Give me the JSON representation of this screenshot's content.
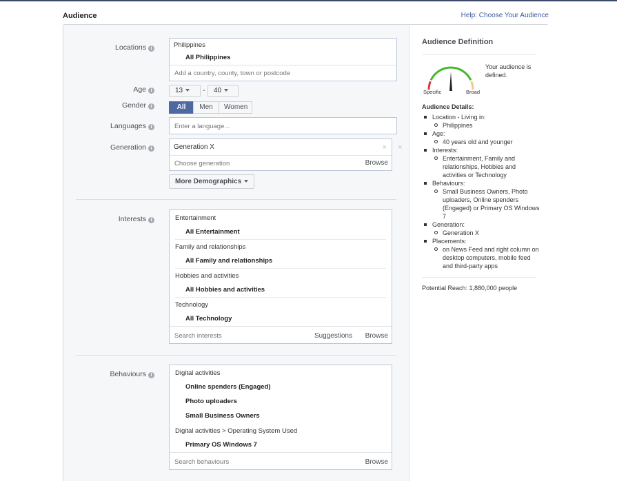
{
  "header": {
    "title": "Audience",
    "help_link": "Help: Choose Your Audience"
  },
  "form": {
    "locations": {
      "label": "Locations",
      "country": "Philippines",
      "item": "All Philippines",
      "placeholder": "Add a country, county, town or postcode"
    },
    "age": {
      "label": "Age",
      "min": "13",
      "separator": "-",
      "max": "40"
    },
    "gender": {
      "label": "Gender",
      "options": [
        "All",
        "Men",
        "Women"
      ],
      "selected": "All"
    },
    "languages": {
      "label": "Languages",
      "placeholder": "Enter a language..."
    },
    "generation": {
      "label": "Generation",
      "value": "Generation X",
      "placeholder": "Choose generation",
      "browse": "Browse",
      "clear_glyph": "×"
    },
    "more_demographics": "More Demographics",
    "interests": {
      "label": "Interests",
      "groups": [
        {
          "category": "Entertainment",
          "items": [
            "All Entertainment"
          ]
        },
        {
          "category": "Family and relationships",
          "items": [
            "All Family and relationships"
          ]
        },
        {
          "category": "Hobbies and activities",
          "items": [
            "All Hobbies and activities"
          ]
        },
        {
          "category": "Technology",
          "items": [
            "All Technology"
          ]
        }
      ],
      "placeholder": "Search interests",
      "suggestions": "Suggestions",
      "browse": "Browse"
    },
    "behaviours": {
      "label": "Behaviours",
      "groups": [
        {
          "category": "Digital activities",
          "items": [
            "Online spenders (Engaged)",
            "Photo uploaders",
            "Small Business Owners"
          ]
        },
        {
          "category": "Digital activities > Operating System Used",
          "items": [
            "Primary OS Windows 7"
          ]
        }
      ],
      "placeholder": "Search behaviours",
      "browse": "Browse"
    }
  },
  "definition": {
    "title": "Audience Definition",
    "gauge_text": "Your audience is defined.",
    "gauge_left": "Specific",
    "gauge_right": "Broad",
    "gauge_level": 0.5,
    "details_title": "Audience Details:",
    "details": [
      {
        "label": "Location - Living in:",
        "values": [
          "Philippines"
        ]
      },
      {
        "label": "Age:",
        "values": [
          "40 years old and younger"
        ]
      },
      {
        "label": "Interests:",
        "values": [
          "Entertainment, Family and relationships, Hobbies and activities or Technology"
        ]
      },
      {
        "label": "Behaviours:",
        "values": [
          "Small Business Owners, Photo uploaders, Online spenders (Engaged) or Primary OS Windows 7"
        ]
      },
      {
        "label": "Generation:",
        "values": [
          "Generation X"
        ]
      },
      {
        "label": "Placements:",
        "values": [
          "on News Feed and right column on desktop computers, mobile feed and third-party apps"
        ]
      }
    ],
    "potential_reach": "Potential Reach: 1,880,000 people"
  },
  "colors": {
    "accent": "#4e69a2",
    "link": "#3b5998",
    "gauge_red": "#d9363e",
    "gauge_green": "#42b72a",
    "gauge_tan": "#f0c987"
  }
}
